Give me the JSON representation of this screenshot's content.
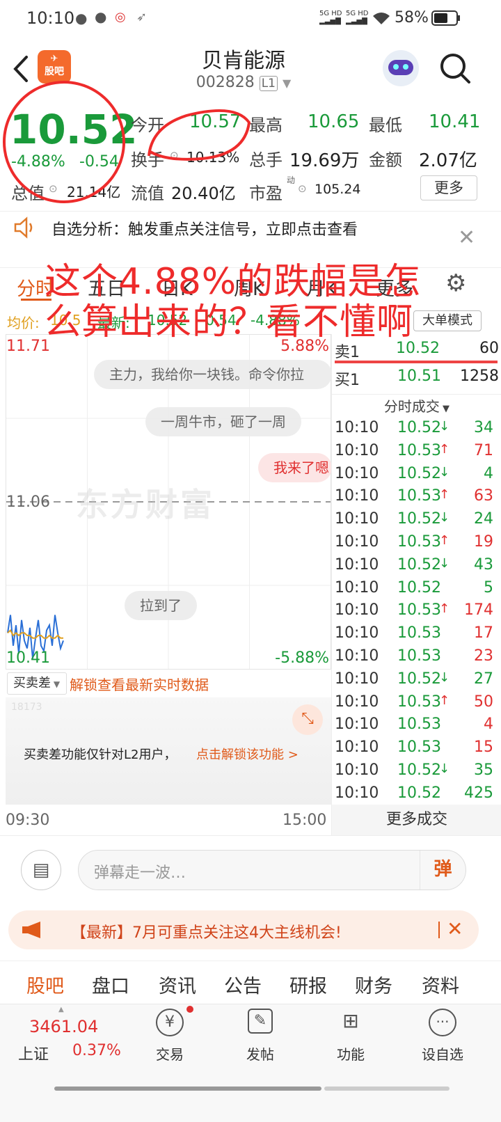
{
  "status": {
    "time": "10:10",
    "signal1": "5G HD",
    "signal2": "5G HD",
    "battery": "58%"
  },
  "header": {
    "title": "贝肯能源",
    "code": "002828",
    "level": "L1",
    "guba_label": "股吧"
  },
  "quote": {
    "price": "10.52",
    "change_pct": "-4.88%",
    "change_abs": "-0.54",
    "open_label": "今开",
    "open": "10.57",
    "high_label": "最高",
    "high": "10.65",
    "low_label": "最低",
    "low": "10.41",
    "turnover_label": "换手",
    "turnover": "10.13%",
    "volume_label": "总手",
    "volume": "19.69万",
    "amount_label": "金额",
    "amount": "2.07亿",
    "mktcap_label": "总值",
    "mktcap": "21.14亿",
    "float_label": "流值",
    "float": "20.40亿",
    "pe_label": "市盈",
    "pe_sup": "动",
    "pe": "105.24",
    "more_button": "更多"
  },
  "notice": {
    "text": "自选分析：触发重点关注信号，立即点击查看"
  },
  "chart_tabs": [
    "分时",
    "五日",
    "日K",
    "周K",
    "月K",
    "更多"
  ],
  "avg_line": {
    "avg_label": "均价:",
    "avg": "10.5",
    "latest_label": "最新:",
    "latest": "10.52",
    "chg": "-0.54",
    "pct": "-4.88%"
  },
  "mode_button": "大单模式",
  "chart": {
    "y_top": "11.71",
    "y_mid": "11.06",
    "y_bot": "10.41",
    "pct_top": "5.88%",
    "pct_bot": "-5.88%",
    "watermark": "东方财富",
    "t_start": "09:30",
    "t_end": "15:00"
  },
  "chart_data": {
    "type": "line",
    "x": [
      "09:30",
      "09:32",
      "09:34",
      "09:36",
      "09:38",
      "09:40",
      "09:42",
      "09:44",
      "09:46",
      "09:48",
      "09:50",
      "09:52",
      "09:54",
      "09:56",
      "09:58",
      "10:00",
      "10:02",
      "10:04",
      "10:06",
      "10:08",
      "10:10"
    ],
    "series": [
      {
        "values": [
          10.55,
          10.62,
          10.5,
          10.58,
          10.47,
          10.6,
          10.52,
          10.49,
          10.57,
          10.45,
          10.53,
          10.6,
          10.5,
          10.48,
          10.56,
          10.58,
          10.5,
          10.62,
          10.55,
          10.49,
          10.52
        ],
        "color": "#2a6fd6"
      },
      {
        "values": [
          10.55,
          10.56,
          10.54,
          10.55,
          10.54,
          10.55,
          10.55,
          10.54,
          10.54,
          10.53,
          10.53,
          10.54,
          10.54,
          10.53,
          10.53,
          10.54,
          10.53,
          10.53,
          10.54,
          10.53,
          10.53
        ],
        "color": "#e0a020"
      }
    ],
    "ylim": [
      10.41,
      11.71
    ]
  },
  "danmaku": [
    "主力，我给你一块钱。命令你拉",
    "一周牛市，砸了一周",
    "我来了嗯",
    "拉到了"
  ],
  "orderbook": [
    {
      "label": "卖1",
      "price": "10.52",
      "vol": "60"
    },
    {
      "label": "买1",
      "price": "10.51",
      "vol": "1258"
    }
  ],
  "ticks_title": "分时成交",
  "ticks": [
    {
      "t": "10:10",
      "p": "10.52",
      "d": "↓",
      "v": "34",
      "c": "green"
    },
    {
      "t": "10:10",
      "p": "10.53",
      "d": "↑",
      "v": "71",
      "c": "red"
    },
    {
      "t": "10:10",
      "p": "10.52",
      "d": "↓",
      "v": "4",
      "c": "green"
    },
    {
      "t": "10:10",
      "p": "10.53",
      "d": "↑",
      "v": "63",
      "c": "red"
    },
    {
      "t": "10:10",
      "p": "10.52",
      "d": "↓",
      "v": "24",
      "c": "green"
    },
    {
      "t": "10:10",
      "p": "10.53",
      "d": "↑",
      "v": "19",
      "c": "red"
    },
    {
      "t": "10:10",
      "p": "10.52",
      "d": "↓",
      "v": "43",
      "c": "green"
    },
    {
      "t": "10:10",
      "p": "10.52",
      "d": "",
      "v": "5",
      "c": "green"
    },
    {
      "t": "10:10",
      "p": "10.53",
      "d": "↑",
      "v": "174",
      "c": "red"
    },
    {
      "t": "10:10",
      "p": "10.53",
      "d": "",
      "v": "17",
      "c": "red"
    },
    {
      "t": "10:10",
      "p": "10.53",
      "d": "",
      "v": "23",
      "c": "red"
    },
    {
      "t": "10:10",
      "p": "10.52",
      "d": "↓",
      "v": "27",
      "c": "green"
    },
    {
      "t": "10:10",
      "p": "10.53",
      "d": "↑",
      "v": "50",
      "c": "red"
    },
    {
      "t": "10:10",
      "p": "10.53",
      "d": "",
      "v": "4",
      "c": "red"
    },
    {
      "t": "10:10",
      "p": "10.53",
      "d": "",
      "v": "15",
      "c": "red"
    },
    {
      "t": "10:10",
      "p": "10.52",
      "d": "↓",
      "v": "35",
      "c": "green"
    },
    {
      "t": "10:10",
      "p": "10.52",
      "d": "",
      "v": "425",
      "c": "green"
    }
  ],
  "more_ticks": "更多成交",
  "spread": {
    "select_label": "买卖差",
    "unlock_text": "解锁查看最新实时数据",
    "hint": "买卖差功能仅针对L2用户，",
    "hint_link": "点击解锁该功能 >",
    "faint_num": "18173"
  },
  "danmaku_input": {
    "placeholder": "弹幕走一波…",
    "send_label": "弹"
  },
  "banner": {
    "text": "【最新】7月可重点关注这4大主线机会!"
  },
  "bottom_tabs": [
    "股吧",
    "盘口",
    "资讯",
    "公告",
    "研报",
    "财务",
    "资料"
  ],
  "bottom_nav": {
    "index_value": "3461.04",
    "index_name": "上证",
    "index_pct": "0.37%",
    "trade": "交易",
    "post": "发帖",
    "func": "功能",
    "watch": "设自选"
  },
  "annotation": {
    "line1": "这个4.88%的跌幅是怎",
    "line2": "么算出来的？看不懂啊"
  }
}
